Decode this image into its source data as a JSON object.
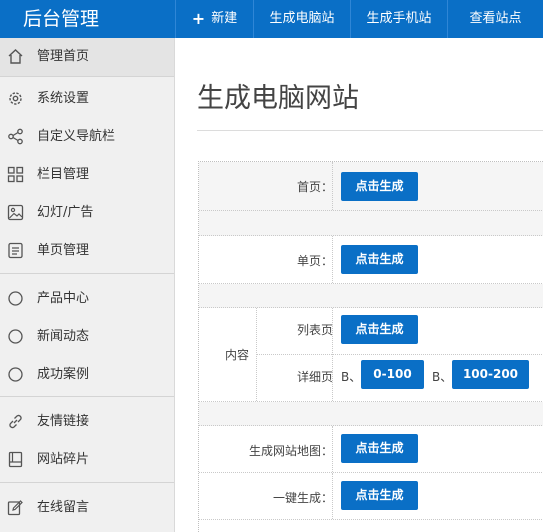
{
  "app": {
    "title": "后台管理"
  },
  "topnav": {
    "new_label": "新建",
    "generate_pc_label": "生成电脑站",
    "generate_mobile_label": "生成手机站",
    "view_site_label": "查看站点"
  },
  "sidebar": {
    "items": [
      {
        "label": "管理首页",
        "icon": "home-icon"
      },
      {
        "label": "系统设置",
        "icon": "gear-icon"
      },
      {
        "label": "自定义导航栏",
        "icon": "share-icon"
      },
      {
        "label": "栏目管理",
        "icon": "grid-icon"
      },
      {
        "label": "幻灯/广告",
        "icon": "image-icon"
      },
      {
        "label": "单页管理",
        "icon": "document-icon"
      },
      {
        "label": "产品中心",
        "icon": "circle-icon"
      },
      {
        "label": "新闻动态",
        "icon": "circle-icon"
      },
      {
        "label": "成功案例",
        "icon": "circle-icon"
      },
      {
        "label": "友情链接",
        "icon": "link-icon"
      },
      {
        "label": "网站碎片",
        "icon": "book-icon"
      },
      {
        "label": "在线留言",
        "icon": "edit-icon"
      }
    ]
  },
  "main": {
    "page_title": "生成电脑网站",
    "rows": {
      "home_label": "首页：",
      "single_label": "单页：",
      "content_label": "内容",
      "list_label": "列表页",
      "detail_label": "详细页",
      "sitemap_label": "生成网站地图：",
      "onekey_label": "一键生成："
    },
    "generate_button": "点击生成",
    "detail_ranges": [
      {
        "prefix": "B、",
        "label": "0-100"
      },
      {
        "prefix": "B、",
        "label": "100-200"
      }
    ]
  },
  "colors": {
    "brand": "#0a6fc6",
    "sidebar_bg": "#f0f0f0",
    "text": "#333333"
  }
}
